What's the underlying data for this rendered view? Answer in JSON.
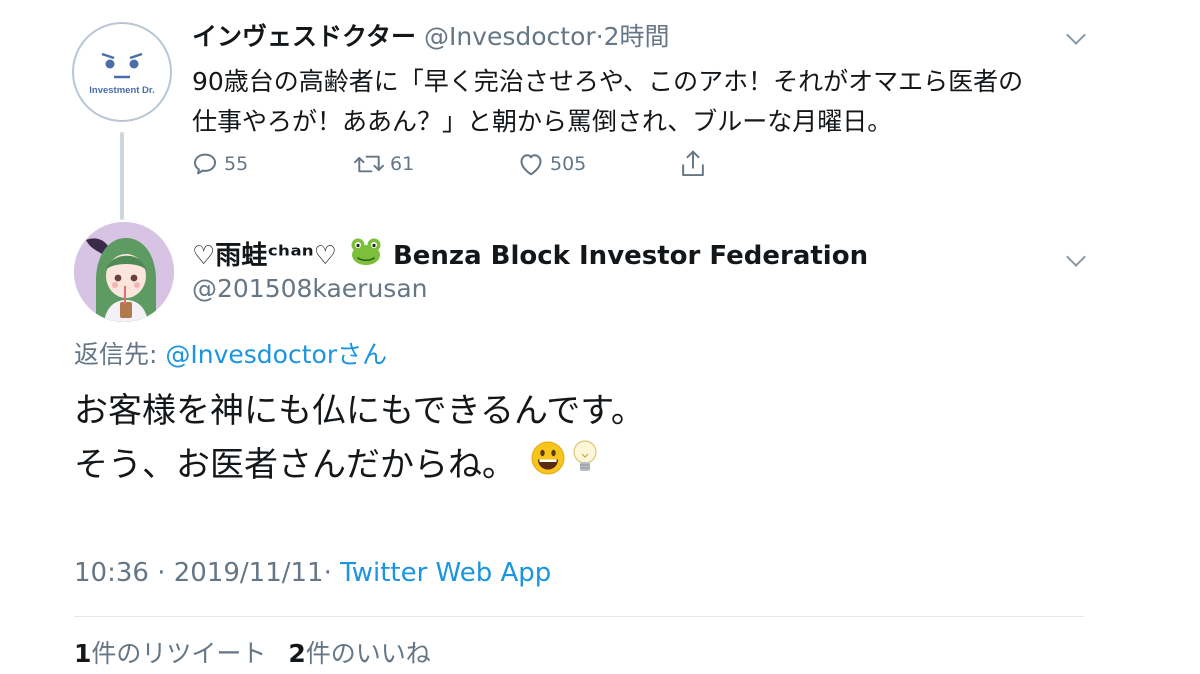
{
  "parent_tweet": {
    "avatar_text": "Investment Dr.",
    "display_name": "インヴェスドクター",
    "handle": "@Invesdoctor",
    "separator": "·",
    "time": "2時間",
    "text_line1": "90歳台の高齢者に「早く完治させろや、このアホ！それがオマエら医者の",
    "text_line2": "仕事やろが！ああん？」と朝から罵倒され、ブルーな月曜日。",
    "actions": {
      "reply_icon": "reply-icon",
      "reply_count": "55",
      "retweet_icon": "retweet-icon",
      "retweet_count": "61",
      "like_icon": "heart-icon",
      "like_count": "505",
      "share_icon": "share-icon"
    }
  },
  "main_tweet": {
    "display_name": "♡雨蛙ᶜʰᵃⁿ♡",
    "name_emoji": "frog-emoji",
    "name_suffix": "Benza Block Investor Federation",
    "handle": "@201508kaerusan",
    "reply_prefix": "返信先:",
    "reply_target": "@Invesdoctorさん",
    "text_line1": "お客様を神にも仏にもできるんです。",
    "text_line2": "そう、お医者さんだからね。",
    "text_emojis": [
      "grinning-face-emoji",
      "light-bulb-emoji"
    ],
    "time": "10:36",
    "meta_separator1": "·",
    "date": "2019/11/11",
    "meta_separator2": "·",
    "source": "Twitter Web App",
    "retweet_count": "1",
    "retweet_label": "件のリツイート",
    "like_count": "2",
    "like_label": "件のいいね"
  },
  "colors": {
    "link": "#1b95e0",
    "muted": "#657786",
    "text": "#14171a",
    "thread_line": "#ccd6dd"
  }
}
